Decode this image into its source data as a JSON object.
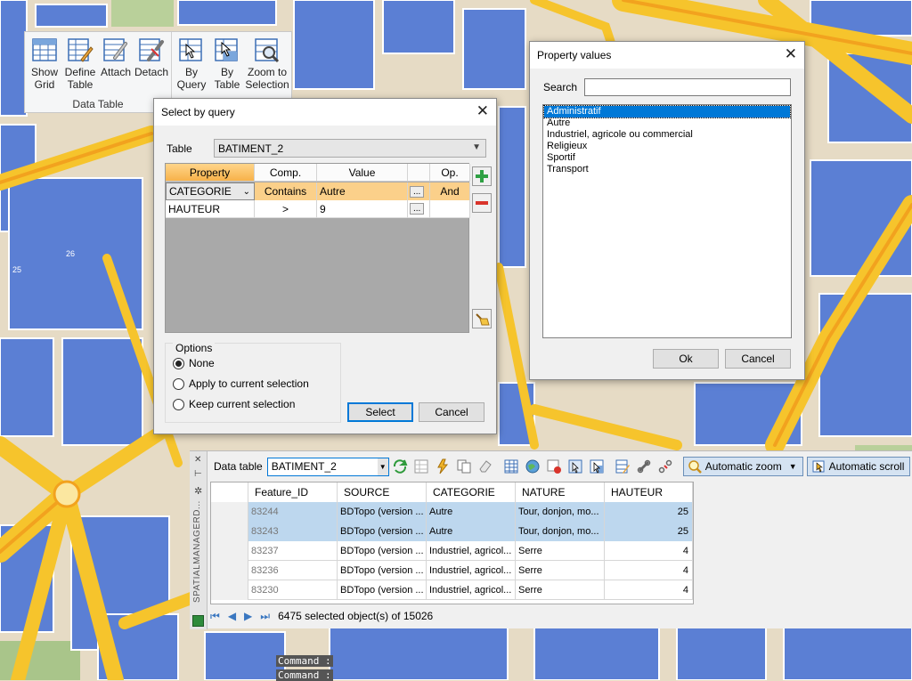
{
  "ribbon": {
    "group_data_table": {
      "label": "Data Table",
      "buttons": [
        {
          "label1": "Show",
          "label2": "Grid"
        },
        {
          "label1": "Define",
          "label2": "Table"
        },
        {
          "label1": "Attach",
          "label2": ""
        },
        {
          "label1": "Detach",
          "label2": ""
        }
      ]
    },
    "group_select": {
      "buttons": [
        {
          "label1": "By",
          "label2": "Query"
        },
        {
          "label1": "By",
          "label2": "Table"
        },
        {
          "label1": "Zoom to",
          "label2": "Selection"
        }
      ]
    }
  },
  "select_by_query": {
    "title": "Select by query",
    "table_label": "Table",
    "table_value": "BATIMENT_2",
    "headers": {
      "property": "Property",
      "comp": "Comp.",
      "value": "Value",
      "op": "Op."
    },
    "rows": [
      {
        "property": "CATEGORIE",
        "comp": "Contains",
        "value": "Autre",
        "ellipsis": "...",
        "op": "And"
      },
      {
        "property": "HAUTEUR",
        "comp": ">",
        "value": "9",
        "ellipsis": "...",
        "op": ""
      }
    ],
    "options_title": "Options",
    "options": [
      "None",
      "Apply to current selection",
      "Keep current selection"
    ],
    "selected_option": "None",
    "select_button": "Select",
    "cancel_button": "Cancel"
  },
  "property_values": {
    "title": "Property values",
    "search_label": "Search",
    "search_value": "",
    "items": [
      "Administratif",
      "Autre",
      "Industriel, agricole ou commercial",
      "Religieux",
      "Sportif",
      "Transport"
    ],
    "selected_item": "Administratif",
    "ok_button": "Ok",
    "cancel_button": "Cancel"
  },
  "data_table": {
    "side_label": "SPATIALMANAGERD...",
    "label": "Data table",
    "table_value": "BATIMENT_2",
    "automatic_zoom": "Automatic zoom",
    "automatic_scroll": "Automatic scroll",
    "columns": [
      "Feature_ID",
      "SOURCE",
      "CATEGORIE",
      "NATURE",
      "HAUTEUR"
    ],
    "rows": [
      {
        "id": "83244",
        "source": "BDTopo (version ...",
        "categorie": "Autre",
        "nature": "Tour, donjon, mo...",
        "hauteur": "25",
        "selected": true
      },
      {
        "id": "83243",
        "source": "BDTopo (version ...",
        "categorie": "Autre",
        "nature": "Tour, donjon, mo...",
        "hauteur": "25",
        "selected": true
      },
      {
        "id": "83237",
        "source": "BDTopo (version ...",
        "categorie": "Industriel, agricol...",
        "nature": "Serre",
        "hauteur": "4",
        "selected": false
      },
      {
        "id": "83236",
        "source": "BDTopo (version ...",
        "categorie": "Industriel, agricol...",
        "nature": "Serre",
        "hauteur": "4",
        "selected": false
      },
      {
        "id": "83230",
        "source": "BDTopo (version ...",
        "categorie": "Industriel, agricol...",
        "nature": "Serre",
        "hauteur": "4",
        "selected": false
      }
    ],
    "status": "6475 selected object(s) of 15026"
  },
  "map": {
    "label_26": "26",
    "label_25": "25",
    "command_line_1": "Command :",
    "command_line_2": "Command :"
  },
  "colors": {
    "map_bg": "#e6dbc5",
    "building_blue": "#5b7fd4",
    "road_yellow": "#f6c42c",
    "road_orange": "#f2a21e",
    "selected_row": "#bdd7ee",
    "accent_blue": "#0078d7"
  }
}
